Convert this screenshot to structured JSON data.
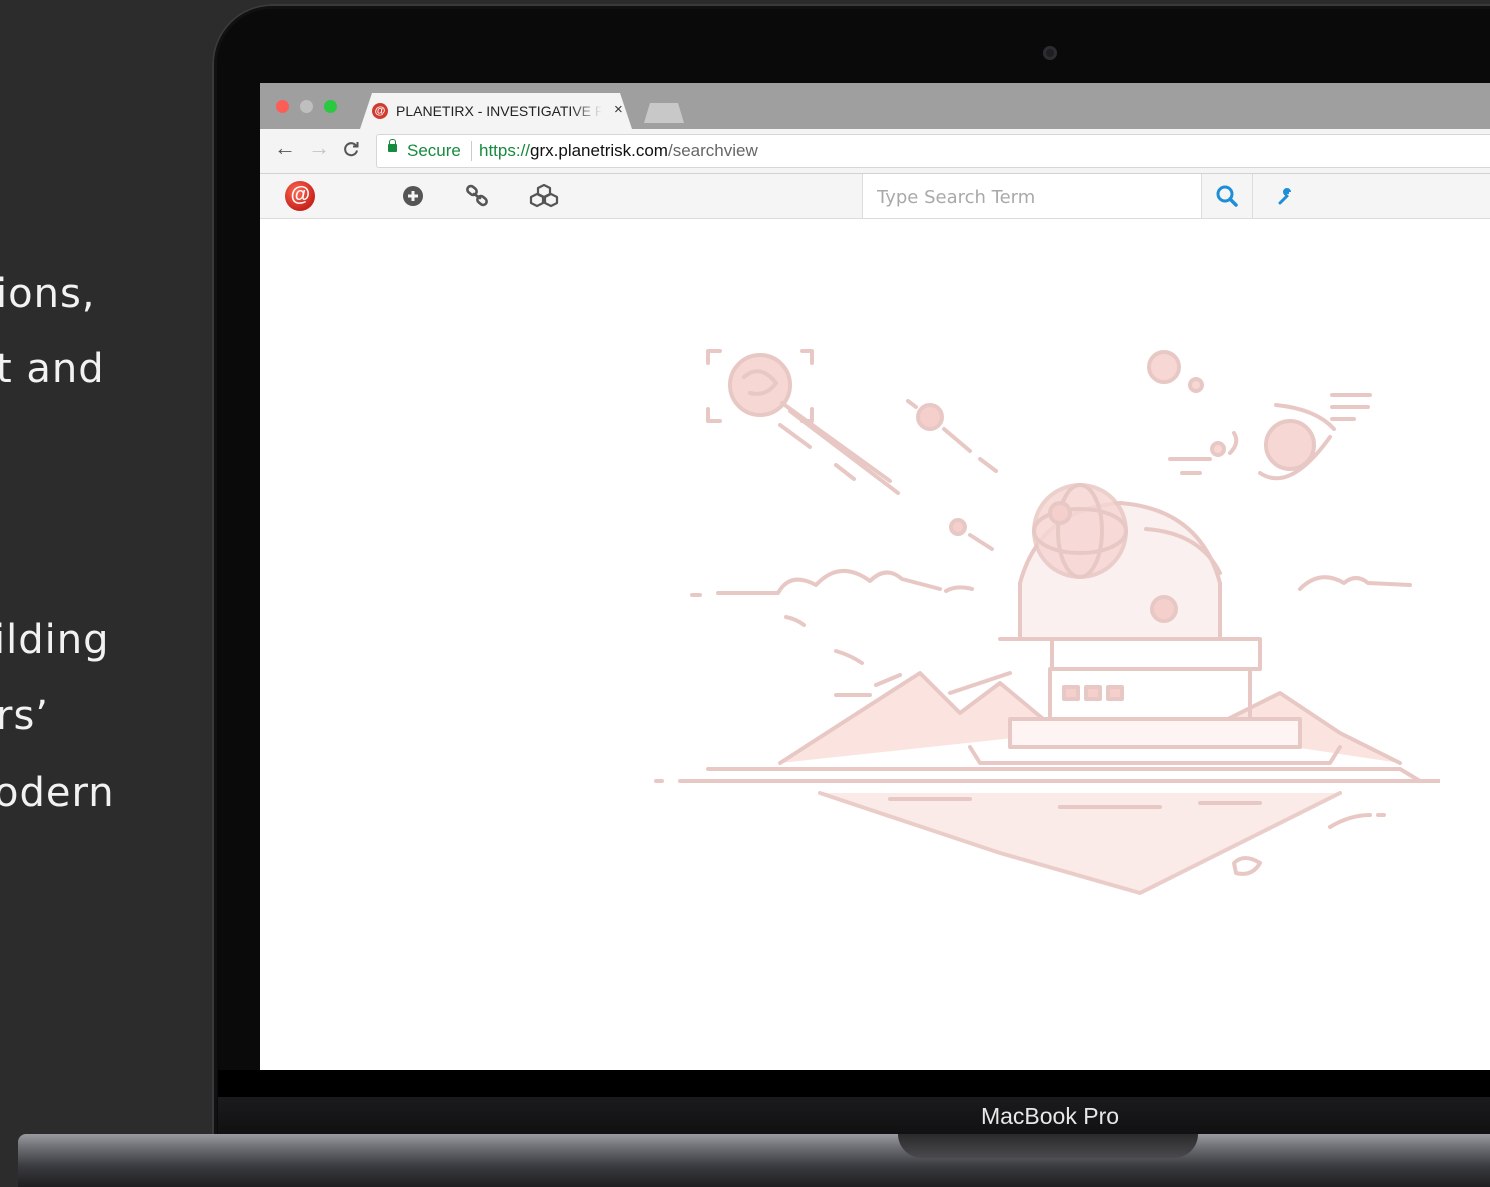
{
  "side_text": {
    "lines": [
      "ions,",
      "t and",
      "ilding",
      "rs’",
      "odern"
    ]
  },
  "device": {
    "brand_label": "MacBook Pro"
  },
  "browser": {
    "tab": {
      "title": "PLANETIRX - INVESTIGATIVE R",
      "close_label": "×"
    },
    "nav": {
      "back": "←",
      "forward": "→",
      "reload": "C"
    },
    "address": {
      "secure_label": "Secure",
      "scheme": "https://",
      "host": "grx.planetrisk.com",
      "path": "/searchview"
    }
  },
  "app": {
    "logo_letter": "@",
    "search": {
      "placeholder": "Type Search Term",
      "value": ""
    },
    "colors": {
      "accent": "#1e8fd6",
      "brand": "#d23b2f",
      "illustration": "#e6a5a0"
    },
    "icons": [
      "plus-circle-icon",
      "link-icon",
      "cubes-icon",
      "search-icon",
      "wrench-icon"
    ]
  }
}
